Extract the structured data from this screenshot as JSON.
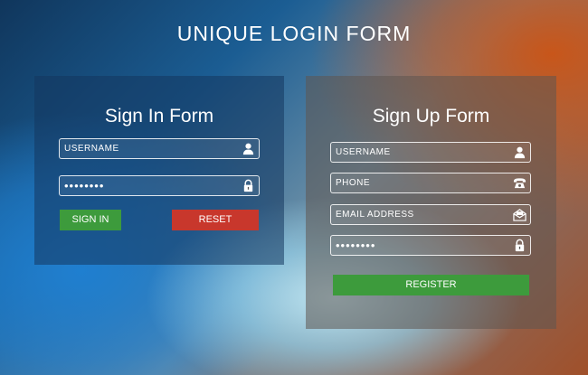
{
  "page": {
    "title": "UNIQUE LOGIN FORM"
  },
  "signin": {
    "title": "Sign In Form",
    "username": {
      "placeholder": "USERNAME",
      "value": "",
      "icon": "user-icon"
    },
    "password": {
      "placeholder": "",
      "value": "••••••••",
      "icon": "lock-icon"
    },
    "signin_label": "SIGN IN",
    "reset_label": "RESET"
  },
  "signup": {
    "title": "Sign Up Form",
    "username": {
      "placeholder": "USERNAME",
      "value": "",
      "icon": "user-icon"
    },
    "phone": {
      "placeholder": "PHONE",
      "value": "",
      "icon": "phone-icon"
    },
    "email": {
      "placeholder": "EMAIL ADDRESS",
      "value": "",
      "icon": "envelope-icon"
    },
    "password": {
      "placeholder": "",
      "value": "••••••••",
      "icon": "lock-icon"
    },
    "register_label": "REGISTER"
  },
  "colors": {
    "green_button": "#3d9b3c",
    "red_button": "#c8372c"
  }
}
